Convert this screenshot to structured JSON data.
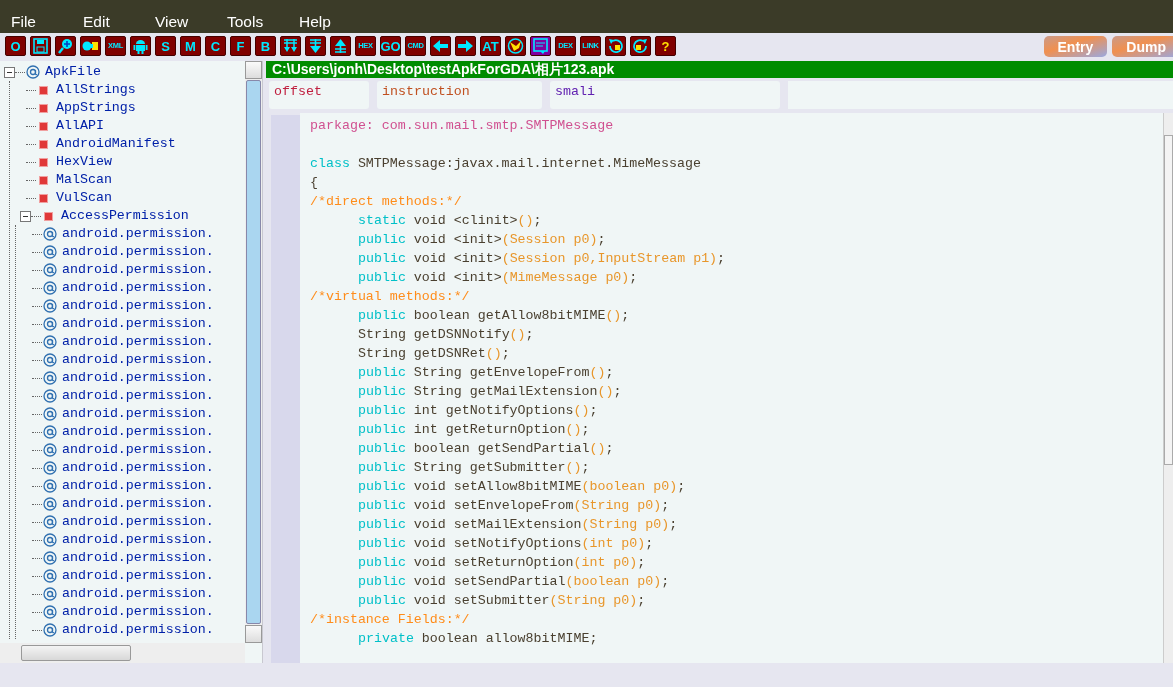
{
  "menu": [
    "File",
    "Edit",
    "View",
    "Tools",
    "Help"
  ],
  "toolbar": [
    {
      "kind": "text",
      "label": "O"
    },
    {
      "kind": "icon"
    },
    {
      "kind": "icon"
    },
    {
      "kind": "icon"
    },
    {
      "kind": "text",
      "label": "XML"
    },
    {
      "kind": "icon"
    },
    {
      "kind": "text",
      "label": "S"
    },
    {
      "kind": "text",
      "label": "M"
    },
    {
      "kind": "text",
      "label": "C"
    },
    {
      "kind": "text",
      "label": "F"
    },
    {
      "kind": "text",
      "label": "B"
    },
    {
      "kind": "icon"
    },
    {
      "kind": "icon"
    },
    {
      "kind": "icon"
    },
    {
      "kind": "text",
      "label": "HEX"
    },
    {
      "kind": "text",
      "label": "GO"
    },
    {
      "kind": "text",
      "label": "CMD"
    },
    {
      "kind": "icon"
    },
    {
      "kind": "icon"
    },
    {
      "kind": "text",
      "label": "AT"
    },
    {
      "kind": "icon"
    },
    {
      "kind": "icon"
    },
    {
      "kind": "text",
      "label": "DEX"
    },
    {
      "kind": "text",
      "label": "LINK"
    },
    {
      "kind": "icon"
    },
    {
      "kind": "icon"
    },
    {
      "kind": "help",
      "label": "?"
    }
  ],
  "side_buttons": [
    "Entry",
    "Dump"
  ],
  "tree": {
    "label": "ApkFile",
    "kind": "root",
    "expanded": true,
    "children": [
      {
        "label": "AllStrings",
        "kind": "node"
      },
      {
        "label": "AppStrings",
        "kind": "node"
      },
      {
        "label": "AllAPI",
        "kind": "node"
      },
      {
        "label": "AndroidManifest",
        "kind": "node"
      },
      {
        "label": "HexView",
        "kind": "node"
      },
      {
        "label": "MalScan",
        "kind": "node"
      },
      {
        "label": "VulScan",
        "kind": "node"
      },
      {
        "label": "AccessPermission",
        "kind": "node",
        "expanded": true,
        "children": [
          {
            "label": "android.permission.",
            "kind": "permission"
          },
          {
            "label": "android.permission.",
            "kind": "permission"
          },
          {
            "label": "android.permission.",
            "kind": "permission"
          },
          {
            "label": "android.permission.",
            "kind": "permission"
          },
          {
            "label": "android.permission.",
            "kind": "permission"
          },
          {
            "label": "android.permission.",
            "kind": "permission"
          },
          {
            "label": "android.permission.",
            "kind": "permission"
          },
          {
            "label": "android.permission.",
            "kind": "permission"
          },
          {
            "label": "android.permission.",
            "kind": "permission"
          },
          {
            "label": "android.permission.",
            "kind": "permission"
          },
          {
            "label": "android.permission.",
            "kind": "permission"
          },
          {
            "label": "android.permission.",
            "kind": "permission"
          },
          {
            "label": "android.permission.",
            "kind": "permission"
          },
          {
            "label": "android.permission.",
            "kind": "permission"
          },
          {
            "label": "android.permission.",
            "kind": "permission"
          },
          {
            "label": "android.permission.",
            "kind": "permission"
          },
          {
            "label": "android.permission.",
            "kind": "permission"
          },
          {
            "label": "android.permission.",
            "kind": "permission"
          },
          {
            "label": "android.permission.",
            "kind": "permission"
          },
          {
            "label": "android.permission.",
            "kind": "permission"
          },
          {
            "label": "android.permission.",
            "kind": "permission"
          },
          {
            "label": "android.permission.",
            "kind": "permission"
          },
          {
            "label": "android.permission.",
            "kind": "permission"
          }
        ]
      }
    ]
  },
  "file_path": "C:\\Users\\jonh\\Desktop\\testApkForGDA\\相片123.apk",
  "columns": [
    "offset",
    "instruction",
    "smali"
  ],
  "code": [
    {
      "kind": "top",
      "segments": [
        {
          "kind": "pkg",
          "text": "parkage: com.sun.mail.smtp.SMTPMessage"
        }
      ]
    },
    {
      "kind": "blank"
    },
    {
      "kind": "top",
      "segments": [
        {
          "kind": "kw",
          "text": "class"
        },
        {
          "kind": "plain",
          "text": " SMTPMessage:javax.mail.internet.MimeMessage"
        }
      ]
    },
    {
      "kind": "top",
      "segments": [
        {
          "kind": "plain",
          "text": "{"
        }
      ]
    },
    {
      "kind": "top",
      "segments": [
        {
          "kind": "comment",
          "text": "/*direct methods:*/"
        }
      ]
    },
    {
      "kind": "member",
      "segments": [
        {
          "kind": "kw",
          "text": "static"
        },
        {
          "kind": "plain",
          "text": " void <clinit>"
        },
        {
          "kind": "paren",
          "text": "()"
        },
        {
          "kind": "plain",
          "text": ";"
        }
      ]
    },
    {
      "kind": "member",
      "segments": [
        {
          "kind": "kw",
          "text": "public"
        },
        {
          "kind": "plain",
          "text": " void <init>"
        },
        {
          "kind": "paren",
          "text": "(Session p0)"
        },
        {
          "kind": "plain",
          "text": ";"
        }
      ]
    },
    {
      "kind": "member",
      "segments": [
        {
          "kind": "kw",
          "text": "public"
        },
        {
          "kind": "plain",
          "text": " void <init>"
        },
        {
          "kind": "paren",
          "text": "(Session p0,InputStream p1)"
        },
        {
          "kind": "plain",
          "text": ";"
        }
      ]
    },
    {
      "kind": "member",
      "segments": [
        {
          "kind": "kw",
          "text": "public"
        },
        {
          "kind": "plain",
          "text": " void <init>"
        },
        {
          "kind": "paren",
          "text": "(MimeMessage p0)"
        },
        {
          "kind": "plain",
          "text": ";"
        }
      ]
    },
    {
      "kind": "top",
      "segments": [
        {
          "kind": "comment",
          "text": "/*virtual methods:*/"
        }
      ]
    },
    {
      "kind": "member",
      "segments": [
        {
          "kind": "kw",
          "text": "public"
        },
        {
          "kind": "plain",
          "text": " boolean getAllow8bitMIME"
        },
        {
          "kind": "paren",
          "text": "()"
        },
        {
          "kind": "plain",
          "text": ";"
        }
      ]
    },
    {
      "kind": "member",
      "segments": [
        {
          "kind": "plain",
          "text": "String getDSNNotify"
        },
        {
          "kind": "paren",
          "text": "()"
        },
        {
          "kind": "plain",
          "text": ";"
        }
      ]
    },
    {
      "kind": "member",
      "segments": [
        {
          "kind": "plain",
          "text": "String getDSNRet"
        },
        {
          "kind": "paren",
          "text": "()"
        },
        {
          "kind": "plain",
          "text": ";"
        }
      ]
    },
    {
      "kind": "member",
      "segments": [
        {
          "kind": "kw",
          "text": "public"
        },
        {
          "kind": "plain",
          "text": " String getEnvelopeFrom"
        },
        {
          "kind": "paren",
          "text": "()"
        },
        {
          "kind": "plain",
          "text": ";"
        }
      ]
    },
    {
      "kind": "member",
      "segments": [
        {
          "kind": "kw",
          "text": "public"
        },
        {
          "kind": "plain",
          "text": " String getMailExtension"
        },
        {
          "kind": "paren",
          "text": "()"
        },
        {
          "kind": "plain",
          "text": ";"
        }
      ]
    },
    {
      "kind": "member",
      "segments": [
        {
          "kind": "kw",
          "text": "public"
        },
        {
          "kind": "plain",
          "text": " int getNotifyOptions"
        },
        {
          "kind": "paren",
          "text": "()"
        },
        {
          "kind": "plain",
          "text": ";"
        }
      ]
    },
    {
      "kind": "member",
      "segments": [
        {
          "kind": "kw",
          "text": "public"
        },
        {
          "kind": "plain",
          "text": " int getReturnOption"
        },
        {
          "kind": "paren",
          "text": "()"
        },
        {
          "kind": "plain",
          "text": ";"
        }
      ]
    },
    {
      "kind": "member",
      "segments": [
        {
          "kind": "kw",
          "text": "public"
        },
        {
          "kind": "plain",
          "text": " boolean getSendPartial"
        },
        {
          "kind": "paren",
          "text": "()"
        },
        {
          "kind": "plain",
          "text": ";"
        }
      ]
    },
    {
      "kind": "member",
      "segments": [
        {
          "kind": "kw",
          "text": "public"
        },
        {
          "kind": "plain",
          "text": " String getSubmitter"
        },
        {
          "kind": "paren",
          "text": "()"
        },
        {
          "kind": "plain",
          "text": ";"
        }
      ]
    },
    {
      "kind": "member",
      "segments": [
        {
          "kind": "kw",
          "text": "public"
        },
        {
          "kind": "plain",
          "text": " void setAllow8bitMIME"
        },
        {
          "kind": "paren",
          "text": "(boolean p0)"
        },
        {
          "kind": "plain",
          "text": ";"
        }
      ]
    },
    {
      "kind": "member",
      "segments": [
        {
          "kind": "kw",
          "text": "public"
        },
        {
          "kind": "plain",
          "text": " void setEnvelopeFrom"
        },
        {
          "kind": "paren",
          "text": "(String p0)"
        },
        {
          "kind": "plain",
          "text": ";"
        }
      ]
    },
    {
      "kind": "member",
      "segments": [
        {
          "kind": "kw",
          "text": "public"
        },
        {
          "kind": "plain",
          "text": " void setMailExtension"
        },
        {
          "kind": "paren",
          "text": "(String p0)"
        },
        {
          "kind": "plain",
          "text": ";"
        }
      ]
    },
    {
      "kind": "member",
      "segments": [
        {
          "kind": "kw",
          "text": "public"
        },
        {
          "kind": "plain",
          "text": " void setNotifyOptions"
        },
        {
          "kind": "paren",
          "text": "(int p0)"
        },
        {
          "kind": "plain",
          "text": ";"
        }
      ]
    },
    {
      "kind": "member",
      "segments": [
        {
          "kind": "kw",
          "text": "public"
        },
        {
          "kind": "plain",
          "text": " void setReturnOption"
        },
        {
          "kind": "paren",
          "text": "(int p0)"
        },
        {
          "kind": "plain",
          "text": ";"
        }
      ]
    },
    {
      "kind": "member",
      "segments": [
        {
          "kind": "kw",
          "text": "public"
        },
        {
          "kind": "plain",
          "text": " void setSendPartial"
        },
        {
          "kind": "paren",
          "text": "(boolean p0)"
        },
        {
          "kind": "plain",
          "text": ";"
        }
      ]
    },
    {
      "kind": "member",
      "segments": [
        {
          "kind": "kw",
          "text": "public"
        },
        {
          "kind": "plain",
          "text": " void setSubmitter"
        },
        {
          "kind": "paren",
          "text": "(String p0)"
        },
        {
          "kind": "plain",
          "text": ";"
        }
      ]
    },
    {
      "kind": "top",
      "segments": [
        {
          "kind": "comment",
          "text": "/*instance Fields:*/"
        }
      ]
    },
    {
      "kind": "member",
      "segments": [
        {
          "kind": "kw",
          "text": "private"
        },
        {
          "kind": "plain",
          "text": " boolean allow8bitMIME;"
        }
      ]
    }
  ]
}
